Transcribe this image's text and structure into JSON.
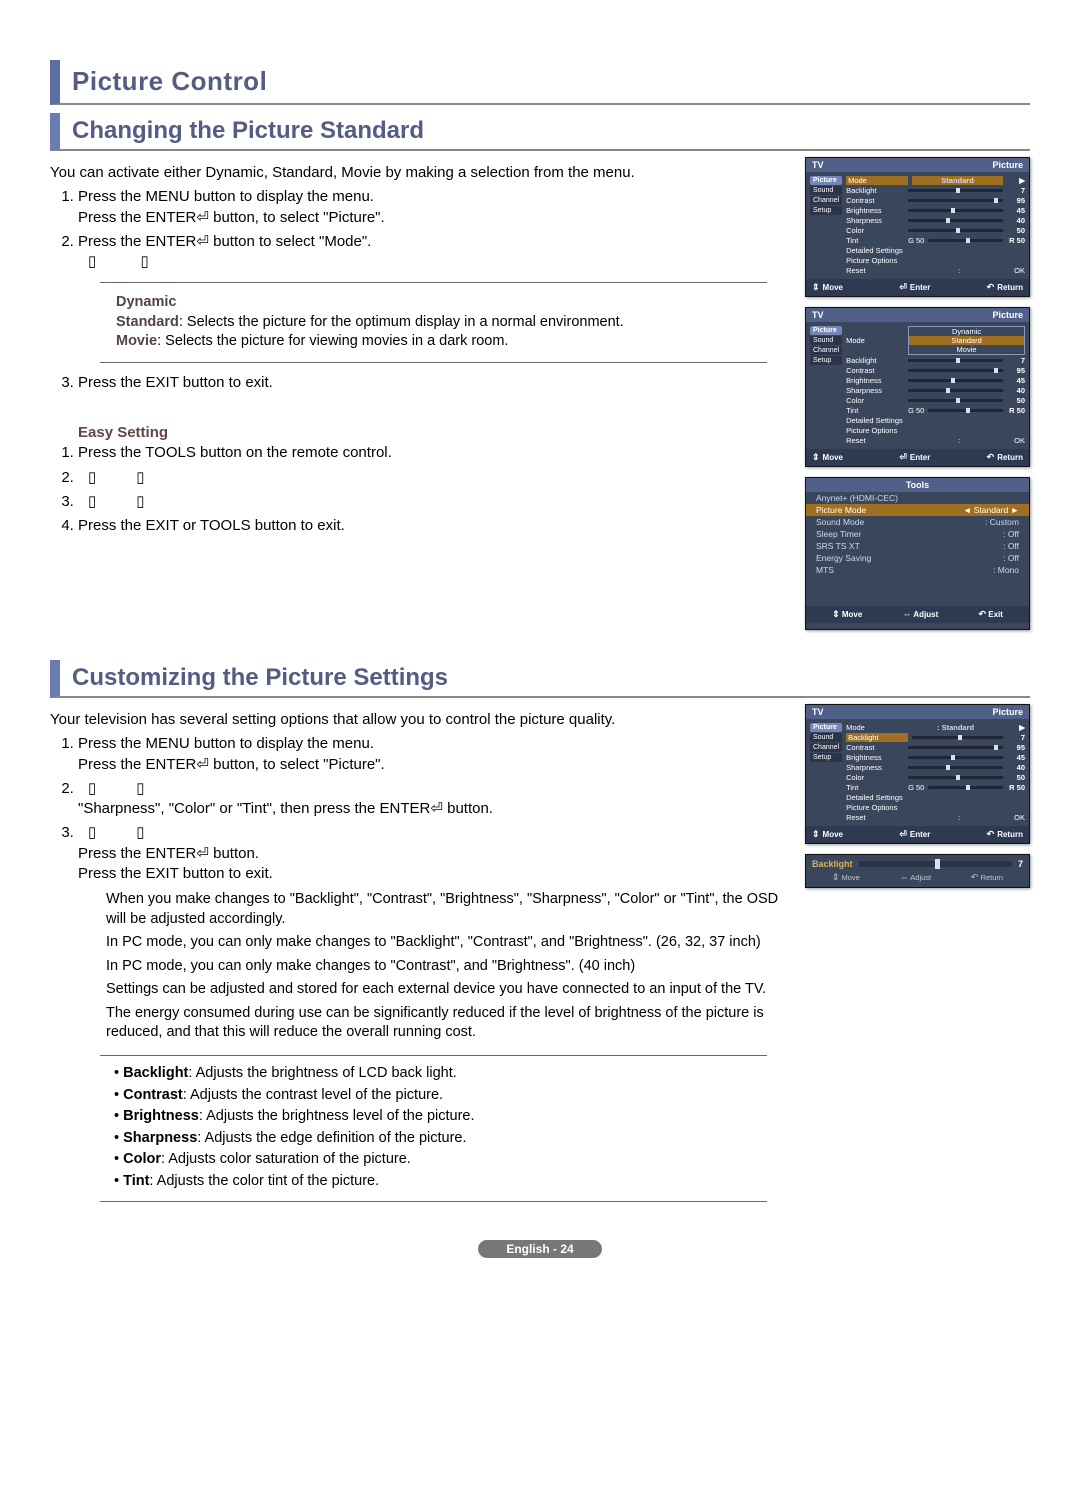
{
  "section": {
    "title": "Picture Control"
  },
  "sub1": {
    "title": "Changing the Picture Standard",
    "intro": "You can activate either Dynamic, Standard, Movie by making a selection from the menu.",
    "step1a": "Press the MENU button to display the menu.",
    "step1b": "Press the ENTER⏎ button, to select \"Picture\".",
    "step2a": "Press the ENTER⏎ button to select \"Mode\".",
    "step2b": "",
    "box_dynamic": "Dynamic",
    "box_std_label": "Standard",
    "box_std_desc": ": Selects the picture for the optimum display in a normal environment.",
    "box_movie_label": "Movie",
    "box_movie_desc": ": Selects the picture for viewing movies in a dark room.",
    "step3": "Press the EXIT button to exit.",
    "easy_title": "Easy Setting",
    "easy1": "Press the TOOLS button on the remote control.",
    "easy2": "",
    "easy3": "",
    "easy4": "Press the EXIT or TOOLS button to exit."
  },
  "sub2": {
    "title": "Customizing the Picture Settings",
    "intro": "Your television has several setting options that allow you to control the picture quality.",
    "step1a": "Press the MENU button to display the menu.",
    "step1b": "Press the ENTER⏎ button, to select \"Picture\".",
    "step2": "\"Sharpness\", \"Color\" or \"Tint\", then press the ENTER⏎ button.",
    "step3a": "Press the ENTER⏎ button.",
    "step3b": "Press the EXIT button to exit.",
    "n1": "When you make changes to \"Backlight\", \"Contrast\", \"Brightness\", \"Sharpness\", \"Color\" or \"Tint\", the OSD will be adjusted accordingly.",
    "n2": "In PC mode, you can only make changes to \"Backlight\", \"Contrast\", and \"Brightness\". (26, 32, 37 inch)",
    "n3": "In PC mode, you can only make changes to \"Contrast\", and \"Brightness\". (40 inch)",
    "n4": "Settings can be adjusted and stored for each external device you have connected to an input of the TV.",
    "n5": "The energy consumed during use can be significantly reduced if the level of brightness of the picture is reduced, and that this will reduce the overall running cost.",
    "b_backlight_l": "Backlight",
    "b_backlight_d": ": Adjusts the brightness of LCD back light.",
    "b_contrast_l": "Contrast",
    "b_contrast_d": ": Adjusts the contrast level of the picture.",
    "b_brightness_l": "Brightness",
    "b_brightness_d": ": Adjusts the brightness level of the picture.",
    "b_sharpness_l": "Sharpness",
    "b_sharpness_d": ": Adjusts the edge definition  of the picture.",
    "b_color_l": "Color",
    "b_color_d": ": Adjusts color saturation of the picture.",
    "b_tint_l": "Tint",
    "b_tint_d": ": Adjusts the color tint of the picture."
  },
  "footer": {
    "page": "English - 24"
  },
  "osd": {
    "tv": "TV",
    "picture": "Picture",
    "side": {
      "picture": "Picture",
      "sound": "Sound",
      "channel": "Channel",
      "setup": "Setup"
    },
    "labels": {
      "mode": "Mode",
      "backlight": "Backlight",
      "contrast": "Contrast",
      "brightness": "Brightness",
      "sharpness": "Sharpness",
      "color": "Color",
      "tint": "Tint",
      "detailed": "Detailed Settings",
      "options": "Picture Options",
      "reset": "Reset",
      "ok": "OK"
    },
    "modes": {
      "standard": "Standard",
      "dynamic": "Dynamic",
      "movie": "Movie"
    },
    "values": {
      "backlight": "7",
      "contrast": "95",
      "brightness": "45",
      "sharpness": "40",
      "color": "50",
      "tint_g": "G 50",
      "tint_r": "R 50"
    },
    "footer": {
      "move": "Move",
      "enter": "Enter",
      "return": "Return"
    }
  },
  "tools": {
    "title": "Tools",
    "rows": {
      "anynet": "Anynet+ (HDMI-CEC)",
      "picmode_l": "Picture Mode",
      "picmode_v": "Standard",
      "sound_l": "Sound Mode",
      "sound_v": "Custom",
      "sleep_l": "Sleep Timer",
      "sleep_v": "Off",
      "srs_l": "SRS TS XT",
      "srs_v": "Off",
      "energy_l": "Energy Saving",
      "energy_v": "Off",
      "mts_l": "MTS",
      "mts_v": "Mono"
    },
    "footer": {
      "move": "Move",
      "adjust": "Adjust",
      "exit": "Exit"
    }
  },
  "adj": {
    "label": "Backlight",
    "value": "7",
    "move": "Move",
    "adjust": "Adjust",
    "return": "Return"
  }
}
